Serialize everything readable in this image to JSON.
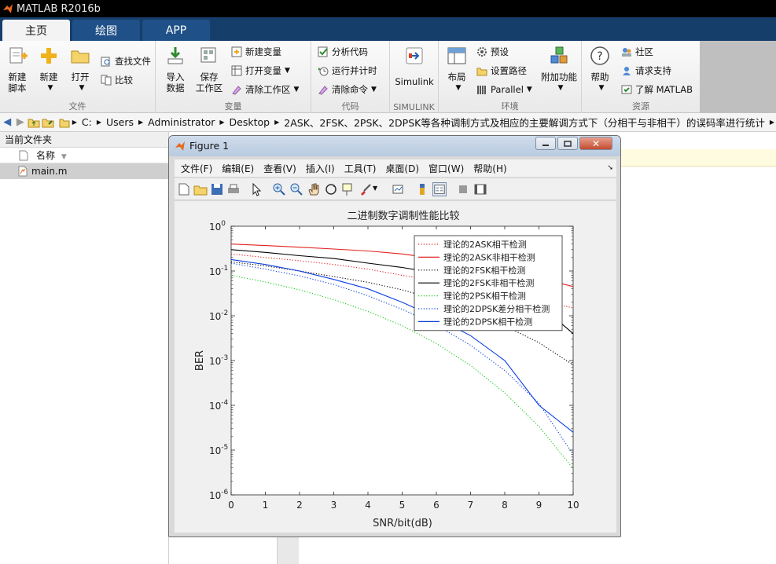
{
  "app": {
    "title": "MATLAB R2016b"
  },
  "tabs": [
    "主页",
    "绘图",
    "APP"
  ],
  "ribbon": {
    "groups": {
      "file": {
        "label": "文件",
        "new_script": "新建\n脚本",
        "new": "新建",
        "open": "打开",
        "find_files": "查找文件",
        "compare": "比较"
      },
      "variable": {
        "label": "变量",
        "import": "导入\n数据",
        "save_ws": "保存\n工作区",
        "new_var": "新建变量",
        "open_var": "打开变量",
        "clear_ws": "清除工作区"
      },
      "code": {
        "label": "代码",
        "analyze": "分析代码",
        "run_time": "运行并计时",
        "clear_cmd": "清除命令"
      },
      "simulink": {
        "label": "SIMULINK",
        "simulink": "Simulink"
      },
      "env": {
        "label": "环境",
        "layout": "布局",
        "prefs": "预设",
        "set_path": "设置路径",
        "parallel": "Parallel",
        "addons": "附加功能"
      },
      "resources": {
        "label": "资源",
        "help": "帮助",
        "community": "社区",
        "support": "请求支持",
        "learn": "了解 MATLAB"
      }
    }
  },
  "address": {
    "crumbs": [
      "C:",
      "Users",
      "Administrator",
      "Desktop",
      "2ASK、2FSK、2PSK、2DPSK等各种调制方式及相应的主要解调方式下（分相干与非相干）的误码率进行统计"
    ]
  },
  "left_panel": {
    "header": "当前文件夹",
    "column": "名称",
    "file": "main.m"
  },
  "figure": {
    "title": "Figure 1",
    "menus": [
      "文件(F)",
      "编辑(E)",
      "查看(V)",
      "插入(I)",
      "工具(T)",
      "桌面(D)",
      "窗口(W)",
      "帮助(H)"
    ]
  },
  "chart_data": {
    "type": "line",
    "title": "二进制数字调制性能比较",
    "xlabel": "SNR/bit(dB)",
    "ylabel": "BER",
    "xlim": [
      0,
      10
    ],
    "ylim": [
      1e-06,
      1
    ],
    "yscale": "log",
    "x": [
      0,
      1,
      2,
      3,
      4,
      5,
      6,
      7,
      8,
      9,
      10
    ],
    "x_ticks": [
      "0",
      "1",
      "2",
      "3",
      "4",
      "5",
      "6",
      "7",
      "8",
      "9",
      "10"
    ],
    "y_ticks": [
      "10^0",
      "10^-1",
      "10^-2",
      "10^-3",
      "10^-4",
      "10^-5",
      "10^-6"
    ],
    "legend_position": "top-right",
    "series": [
      {
        "name": "理论的2ASK相干检测",
        "color": "#e0211e",
        "dash": "dotted",
        "values": [
          0.24,
          0.2,
          0.17,
          0.14,
          0.11,
          0.08,
          0.06,
          0.045,
          0.033,
          0.022,
          0.015
        ]
      },
      {
        "name": "理论的2ASK非相干检测",
        "color": "#e0211e",
        "dash": "solid",
        "values": [
          0.4,
          0.37,
          0.34,
          0.31,
          0.28,
          0.24,
          0.19,
          0.14,
          0.1,
          0.07,
          0.045
        ]
      },
      {
        "name": "理论的2FSK相干检测",
        "color": "#000000",
        "dash": "dotted",
        "values": [
          0.16,
          0.13,
          0.1,
          0.075,
          0.056,
          0.038,
          0.023,
          0.0125,
          0.006,
          0.0025,
          0.0008
        ]
      },
      {
        "name": "理论的2FSK非相干检测",
        "color": "#000000",
        "dash": "solid",
        "values": [
          0.3,
          0.26,
          0.22,
          0.19,
          0.15,
          0.12,
          0.09,
          0.06,
          0.035,
          0.018,
          0.004
        ]
      },
      {
        "name": "理论的2PSK相干检测",
        "color": "#19c919",
        "dash": "dotted",
        "values": [
          0.08,
          0.057,
          0.038,
          0.023,
          0.0125,
          0.006,
          0.0024,
          0.00078,
          0.00019,
          3.36e-05,
          3.9e-06
        ]
      },
      {
        "name": "理论的2DPSK差分相干检测",
        "color": "#0a3ee0",
        "dash": "dotted",
        "values": [
          0.15,
          0.11,
          0.078,
          0.05,
          0.028,
          0.014,
          0.0062,
          0.0022,
          0.0006,
          0.00011,
          8e-06
        ]
      },
      {
        "name": "理论的2DPSK相干检测",
        "color": "#0a3ee0",
        "dash": "solid",
        "values": [
          0.18,
          0.14,
          0.1,
          0.065,
          0.04,
          0.02,
          0.009,
          0.0036,
          0.001,
          0.0001,
          2.5e-05
        ]
      }
    ]
  }
}
